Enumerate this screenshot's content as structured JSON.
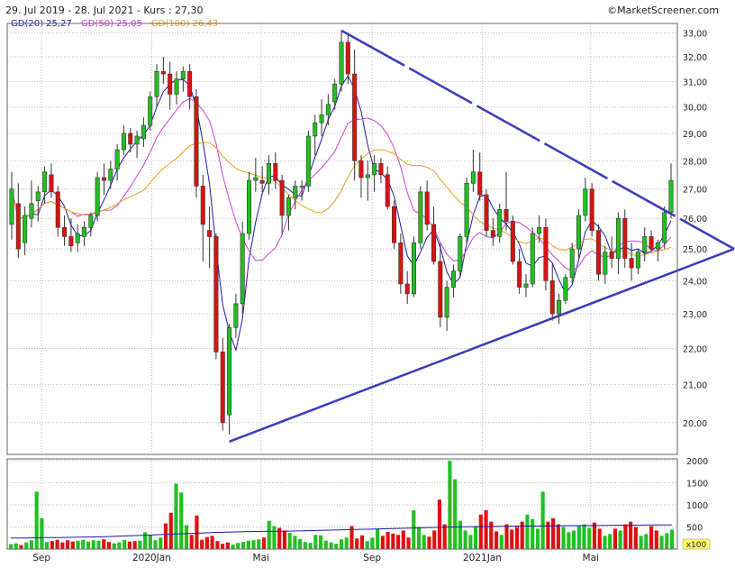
{
  "header": {
    "range_text": "29. Jul 2019 - 28. Jul 2021 - Kurs : 27,30",
    "source": "©MarketScreener.com"
  },
  "legend": [
    {
      "label": "GD(20)",
      "value": "25,27",
      "color": "#1a1aa6"
    },
    {
      "label": "GD(50)",
      "value": "25,05",
      "color": "#d040d0"
    },
    {
      "label": "GD(100)",
      "value": "26,43",
      "color": "#e8a020"
    }
  ],
  "chart_data": [
    {
      "type": "candlestick",
      "title": "29. Jul 2019 - 28. Jul 2021 - Kurs : 27,30",
      "x_range": [
        "2019-07-29",
        "2021-07-28"
      ],
      "ylim": [
        19.2,
        33.4
      ],
      "y_scale": "log",
      "y_ticks": [
        "20,00",
        "21,00",
        "22,00",
        "23,00",
        "24,00",
        "25,00",
        "26,00",
        "27,00",
        "28,00",
        "29,00",
        "30,00",
        "31,00",
        "32,00",
        "33,00"
      ],
      "x_ticks": [
        "Sep",
        "2020Jan",
        "Mai",
        "Sep",
        "2021Jan",
        "Mai"
      ],
      "grid": true,
      "up_color": "#22c022",
      "down_color": "#dd1111",
      "candles": [
        [
          25.8,
          27.6,
          25.3,
          27.0
        ],
        [
          26.5,
          27.2,
          24.7,
          25.0
        ],
        [
          25.2,
          26.4,
          24.8,
          26.1
        ],
        [
          26.0,
          27.3,
          25.7,
          26.5
        ],
        [
          26.6,
          27.1,
          25.9,
          26.9
        ],
        [
          26.9,
          27.8,
          26.5,
          27.6
        ],
        [
          27.5,
          27.9,
          26.7,
          26.9
        ],
        [
          26.9,
          27.1,
          25.4,
          25.7
        ],
        [
          25.7,
          26.1,
          25.1,
          25.4
        ],
        [
          25.4,
          26.0,
          24.9,
          25.1
        ],
        [
          25.2,
          25.8,
          24.9,
          25.5
        ],
        [
          25.4,
          25.9,
          25.1,
          25.7
        ],
        [
          25.7,
          26.2,
          25.4,
          26.1
        ],
        [
          26.1,
          27.6,
          25.9,
          27.4
        ],
        [
          27.4,
          27.9,
          26.8,
          27.3
        ],
        [
          27.3,
          28.0,
          27.0,
          27.7
        ],
        [
          27.7,
          28.6,
          27.3,
          28.4
        ],
        [
          28.4,
          29.3,
          28.2,
          29.0
        ],
        [
          29.0,
          29.2,
          28.3,
          28.6
        ],
        [
          28.6,
          29.1,
          28.1,
          28.9
        ],
        [
          28.8,
          29.6,
          28.5,
          29.3
        ],
        [
          29.3,
          30.6,
          29.1,
          30.4
        ],
        [
          30.4,
          31.7,
          30.0,
          31.4
        ],
        [
          31.4,
          32.0,
          30.9,
          31.3
        ],
        [
          31.3,
          31.8,
          29.9,
          30.5
        ],
        [
          30.5,
          31.4,
          30.1,
          31.1
        ],
        [
          31.1,
          31.6,
          30.6,
          31.4
        ],
        [
          31.4,
          31.7,
          29.9,
          30.4
        ],
        [
          30.4,
          30.7,
          26.7,
          27.1
        ],
        [
          27.1,
          27.5,
          24.6,
          25.8
        ],
        [
          25.6,
          26.4,
          24.4,
          25.4
        ],
        [
          25.4,
          25.5,
          21.7,
          21.9
        ],
        [
          21.9,
          22.3,
          19.8,
          20.0
        ],
        [
          20.2,
          22.7,
          19.7,
          22.6
        ],
        [
          22.6,
          23.6,
          22.3,
          23.3
        ],
        [
          23.3,
          25.9,
          23.0,
          25.5
        ],
        [
          25.5,
          27.6,
          25.3,
          27.3
        ],
        [
          27.3,
          28.1,
          26.9,
          27.4
        ],
        [
          27.3,
          27.8,
          26.9,
          27.2
        ],
        [
          27.2,
          28.2,
          26.8,
          27.9
        ],
        [
          27.9,
          28.3,
          27.0,
          27.3
        ],
        [
          27.3,
          27.5,
          25.5,
          26.1
        ],
        [
          26.1,
          26.8,
          25.6,
          26.7
        ],
        [
          26.7,
          27.3,
          26.3,
          27.1
        ],
        [
          27.1,
          27.3,
          26.6,
          27.1
        ],
        [
          27.1,
          29.1,
          26.9,
          28.9
        ],
        [
          28.9,
          29.7,
          28.2,
          29.4
        ],
        [
          29.4,
          30.3,
          28.9,
          29.7
        ],
        [
          29.7,
          30.5,
          29.3,
          30.1
        ],
        [
          30.2,
          31.1,
          29.9,
          30.9
        ],
        [
          30.9,
          33.1,
          30.6,
          32.6
        ],
        [
          32.6,
          32.9,
          30.9,
          31.3
        ],
        [
          31.3,
          32.3,
          27.3,
          28.0
        ],
        [
          28.0,
          28.2,
          26.7,
          27.4
        ],
        [
          27.4,
          28.0,
          26.6,
          27.5
        ],
        [
          27.5,
          28.2,
          26.9,
          27.9
        ],
        [
          27.9,
          28.1,
          27.2,
          27.5
        ],
        [
          27.5,
          27.8,
          26.3,
          26.4
        ],
        [
          26.4,
          26.6,
          25.0,
          25.2
        ],
        [
          25.2,
          25.5,
          23.6,
          23.9
        ],
        [
          23.9,
          24.3,
          23.3,
          23.6
        ],
        [
          23.6,
          25.4,
          23.5,
          25.2
        ],
        [
          25.2,
          27.1,
          25.0,
          26.9
        ],
        [
          26.9,
          27.3,
          25.6,
          25.8
        ],
        [
          25.8,
          26.4,
          24.5,
          24.6
        ],
        [
          24.6,
          25.2,
          22.6,
          22.9
        ],
        [
          22.9,
          24.0,
          22.5,
          23.8
        ],
        [
          23.8,
          24.5,
          23.5,
          24.3
        ],
        [
          24.3,
          25.5,
          24.1,
          25.4
        ],
        [
          25.4,
          27.4,
          25.2,
          27.2
        ],
        [
          27.2,
          28.4,
          26.9,
          27.6
        ],
        [
          27.6,
          28.3,
          26.6,
          26.8
        ],
        [
          26.8,
          27.0,
          25.4,
          25.6
        ],
        [
          25.6,
          26.0,
          25.1,
          25.4
        ],
        [
          25.4,
          26.5,
          25.2,
          26.3
        ],
        [
          26.3,
          27.6,
          25.6,
          25.9
        ],
        [
          25.9,
          26.1,
          24.5,
          24.6
        ],
        [
          24.6,
          25.0,
          23.6,
          23.8
        ],
        [
          23.8,
          24.2,
          23.5,
          23.9
        ],
        [
          23.9,
          25.7,
          23.8,
          25.5
        ],
        [
          25.5,
          26.1,
          25.2,
          25.7
        ],
        [
          25.7,
          26.0,
          23.7,
          24.0
        ],
        [
          24.0,
          24.5,
          22.8,
          23.0
        ],
        [
          23.0,
          23.6,
          22.7,
          23.4
        ],
        [
          23.4,
          24.2,
          23.3,
          24.1
        ],
        [
          24.1,
          25.2,
          23.9,
          25.0
        ],
        [
          25.0,
          26.3,
          24.7,
          26.1
        ],
        [
          26.1,
          27.4,
          25.9,
          27.0
        ],
        [
          27.0,
          27.2,
          25.4,
          25.6
        ],
        [
          25.6,
          25.8,
          24.0,
          24.2
        ],
        [
          24.2,
          25.1,
          23.9,
          24.9
        ],
        [
          24.9,
          25.4,
          24.4,
          24.7
        ],
        [
          24.7,
          26.2,
          24.2,
          26.0
        ],
        [
          26.0,
          26.3,
          24.4,
          24.7
        ],
        [
          24.7,
          25.2,
          24.0,
          24.4
        ],
        [
          24.4,
          25.0,
          24.2,
          24.9
        ],
        [
          24.9,
          25.7,
          24.6,
          25.4
        ],
        [
          25.4,
          25.6,
          24.9,
          25.0
        ],
        [
          25.0,
          25.3,
          24.6,
          25.2
        ],
        [
          25.2,
          26.4,
          25.0,
          26.2
        ],
        [
          26.2,
          27.9,
          26.0,
          27.3
        ]
      ],
      "volume": {
        "axis_label": "x100",
        "ylim": [
          0,
          2000
        ],
        "ticks": [
          "500",
          "1000",
          "1500",
          "2000"
        ],
        "values": [
          110,
          130,
          90,
          150,
          200,
          1300,
          700,
          160,
          180,
          210,
          150,
          200,
          170,
          190,
          210,
          170,
          200,
          190,
          220,
          160,
          130,
          150,
          210,
          170,
          180,
          190,
          380,
          310,
          200,
          260,
          580,
          820,
          1480,
          1280,
          540,
          320,
          760,
          210,
          270,
          300,
          180,
          120,
          150,
          100,
          140,
          160,
          190,
          200,
          220,
          260,
          640,
          520,
          480,
          420,
          370,
          300,
          230,
          160,
          140,
          320,
          310,
          190,
          150,
          120,
          220,
          260,
          520,
          240,
          310,
          180,
          260,
          460,
          300,
          390,
          350,
          320,
          420,
          260,
          880,
          500,
          320,
          280,
          420,
          1120,
          560,
          2000,
          1580,
          640,
          420,
          320,
          520,
          780,
          880,
          620,
          400,
          320,
          560,
          440,
          500,
          620,
          780,
          680,
          460,
          1300,
          620,
          700,
          560,
          500,
          380,
          420,
          520,
          560,
          480,
          600,
          460,
          300,
          340,
          460,
          420,
          560,
          620,
          500,
          300,
          340,
          520,
          420,
          300,
          360,
          440
        ],
        "avg_line": [
          250,
          250,
          260,
          260,
          270,
          275,
          285,
          300,
          315,
          330,
          345,
          360,
          375,
          385,
          395,
          400,
          405,
          410,
          420,
          430,
          440,
          450,
          460,
          470,
          480,
          490,
          500,
          505,
          510,
          515,
          520,
          520,
          525,
          530,
          530,
          535,
          540,
          540,
          545,
          545
        ]
      }
    }
  ]
}
